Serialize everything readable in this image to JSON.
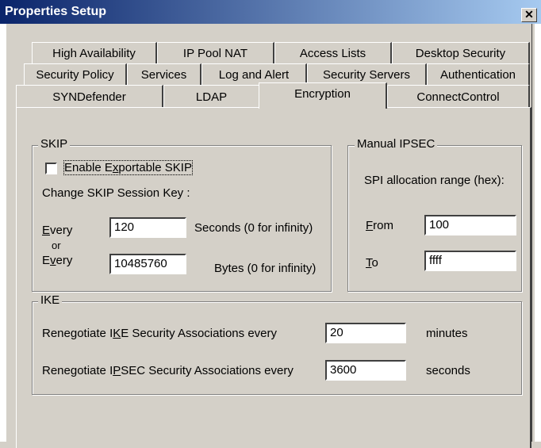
{
  "window": {
    "title": "Properties Setup",
    "close_glyph": "✕"
  },
  "tabs": {
    "row1": [
      "High Availability",
      "IP Pool NAT",
      "Access Lists",
      "Desktop Security"
    ],
    "row2": [
      "Security Policy",
      "Services",
      "Log and Alert",
      "Security Servers",
      "Authentication"
    ],
    "row3": [
      "SYNDefender",
      "LDAP",
      "Encryption",
      "ConnectControl"
    ],
    "active": "Encryption"
  },
  "skip": {
    "legend": "SKIP",
    "enable_label_pre": "Enable E",
    "enable_label_u": "x",
    "enable_label_post": "portable SKIP",
    "enable_checked": false,
    "change_key_label": "Change SKIP Session Key :",
    "every1_u": "E",
    "every1_rest": "very",
    "every1_value": "120",
    "every1_unit": "Seconds (0 for infinity)",
    "or_label": "or",
    "every2_pre": "E",
    "every2_u": "v",
    "every2_rest": "ery",
    "every2_value": "10485760",
    "every2_unit": "Bytes (0 for infinity)"
  },
  "ipsec": {
    "legend": "Manual IPSEC",
    "spi_label": "SPI allocation range (hex):",
    "from_u": "F",
    "from_rest": "rom",
    "from_value": "100",
    "to_u": "T",
    "to_rest": "o",
    "to_value": "ffff"
  },
  "ike": {
    "legend": "IKE",
    "ike_label_pre": "Renegotiate I",
    "ike_label_u": "K",
    "ike_label_post": "E Security Associations every",
    "ike_value": "20",
    "ike_unit": "minutes",
    "ipsec_label_pre": "Renegotiate I",
    "ipsec_label_u": "P",
    "ipsec_label_post": "SEC Security Associations every",
    "ipsec_value": "3600",
    "ipsec_unit": "seconds"
  }
}
